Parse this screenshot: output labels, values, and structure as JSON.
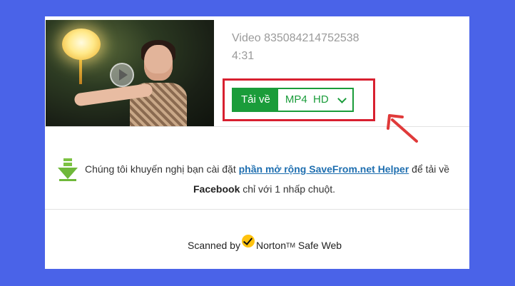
{
  "video": {
    "title": "Video 835084214752538",
    "duration": "4:31"
  },
  "download": {
    "button_label": "Tải về",
    "format_value": "MP4  HD",
    "highlight_color": "#d82030",
    "accent_color": "#1a9c3a"
  },
  "recommendation": {
    "prefix": "Chúng tôi khuyến nghị bạn cài đặt ",
    "link_text": "phần mở rộng SaveFrom.net Helper",
    "suffix": " để tải về",
    "brand": "Facebook",
    "tail": " chỉ với 1 nhấp chuột."
  },
  "footer": {
    "scanned_by": "Scanned by",
    "norton": "Norton",
    "tm": "TM",
    "safe_web": " Safe Web"
  },
  "colors": {
    "background": "#4a63e8",
    "panel": "#ffffff",
    "link": "#1f6fb0"
  },
  "icons": {
    "thumbnail_play": "play-icon",
    "download_arrow": "download-arrow-icon",
    "norton_check": "norton-check-icon",
    "pointer_arrow": "red-pointer-arrow-icon"
  }
}
